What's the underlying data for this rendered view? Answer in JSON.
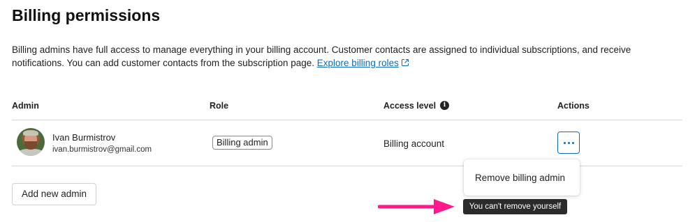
{
  "page": {
    "title": "Billing permissions",
    "description_text": "Billing admins have full access to manage everything in your billing account. Customer contacts are assigned to individual subscriptions, and receive notifications. You can add customer contacts from the subscription page.",
    "description_link": "Explore billing roles"
  },
  "table": {
    "headers": {
      "admin": "Admin",
      "role": "Role",
      "access_level": "Access level",
      "actions": "Actions"
    },
    "rows": [
      {
        "name": "Ivan Burmistrov",
        "email": "ivan.burmistrov@gmail.com",
        "role": "Billing admin",
        "access_level": "Billing account"
      }
    ]
  },
  "add_button_label": "Add new admin",
  "context_menu": {
    "items": [
      "Remove billing admin"
    ]
  },
  "tooltip": "You can't remove yourself",
  "colors": {
    "accent": "#0f6cbd",
    "arrow": "#ff1a8c",
    "tooltip_bg": "#2b2b2b"
  },
  "icons": {
    "external_link": "external-link-icon",
    "info": "info-icon",
    "more": "more-horizontal-icon"
  }
}
